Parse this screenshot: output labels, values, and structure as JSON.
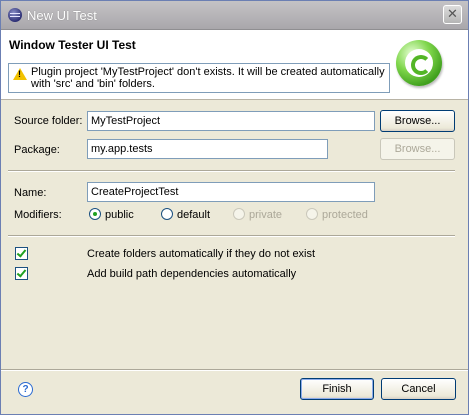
{
  "window": {
    "title": "New UI Test",
    "close_symbol": "✕",
    "icon": "eclipse-icon"
  },
  "banner": {
    "title": "Window Tester UI Test",
    "message": "Plugin project 'MyTestProject' don't exists. It will be created automatically with 'src' and 'bin' folders.",
    "message_icon": "warning-icon",
    "logo_icon": "wizard-logo-icon"
  },
  "form": {
    "source_folder_label": "Source folder:",
    "source_folder_value": "MyTestProject",
    "package_label": "Package:",
    "package_value": "my.app.tests",
    "browse_label": "Browse...",
    "name_label": "Name:",
    "name_value": "CreateProjectTest",
    "modifiers_label": "Modifiers:",
    "modifiers": [
      {
        "label": "public",
        "checked": true,
        "enabled": true
      },
      {
        "label": "default",
        "checked": false,
        "enabled": true
      },
      {
        "label": "private",
        "checked": false,
        "enabled": false
      },
      {
        "label": "protected",
        "checked": false,
        "enabled": false
      }
    ],
    "options": [
      {
        "label": "Create folders automatically if they do not exist",
        "checked": true
      },
      {
        "label": "Add build path dependencies automatically",
        "checked": true
      }
    ]
  },
  "footer": {
    "help_symbol": "?",
    "finish_label": "Finish",
    "cancel_label": "Cancel"
  },
  "colors": {
    "accent_green": "#21a121",
    "titlebar": "#a9a7ab",
    "dialog_bg": "#ece9d8"
  }
}
